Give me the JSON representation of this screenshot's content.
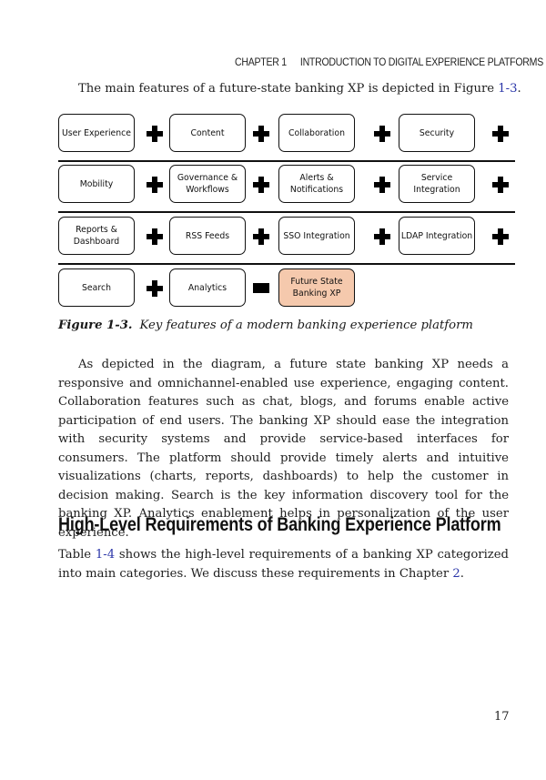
{
  "running_head": {
    "chapter": "CHAPTER 1",
    "title": "INTRODUCTION TO DIGITAL EXPERIENCE PLATFORMS"
  },
  "intro": {
    "before": "The main features of a future-state banking XP is depicted in Figure ",
    "link": "1-3",
    "after": "."
  },
  "diagram": {
    "rows": [
      {
        "items": [
          "User Experience",
          "Content",
          "Collaboration",
          "Security"
        ],
        "operators": [
          "plus",
          "plus",
          "plus",
          "plus"
        ]
      },
      {
        "items": [
          "Mobility",
          "Governance & Workflows",
          "Alerts & Notifications",
          "Service Integration"
        ],
        "operators": [
          "plus",
          "plus",
          "plus",
          "plus"
        ]
      },
      {
        "items": [
          "Reports & Dashboard",
          "RSS Feeds",
          "SSO Integration",
          "LDAP Integration"
        ],
        "operators": [
          "plus",
          "plus",
          "plus",
          "plus"
        ]
      },
      {
        "items": [
          "Search",
          "Analytics",
          "Future State Banking XP"
        ],
        "operators": [
          "plus",
          "equals"
        ]
      }
    ],
    "result_color": "#f5c9ad"
  },
  "caption": {
    "label": "Figure 1-3.",
    "text": "Key features of a modern banking experience platform"
  },
  "paragraph1": "As depicted in the diagram, a future state banking XP needs a responsive and omnichannel-enabled use experience, engaging content. Collaboration features such as chat, blogs, and forums enable active participation of end users. The banking XP should ease the integration with security systems and provide service-based interfaces for consumers. The platform should provide timely alerts and intuitive visualizations (charts, reports, dashboards) to help the customer in decision making. Search is the key information discovery tool for the banking XP. Analytics enablement helps in personalization of the user experience.",
  "heading": "High-Level Requirements of Banking Experience Platform",
  "paragraph2": {
    "t1": "Table ",
    "link1": "1-4",
    "t2": " shows the high-level requirements of a banking XP categorized into main categories. We discuss these requirements in Chapter ",
    "link2": "2",
    "t3": "."
  },
  "page_number": "17",
  "colors": {
    "link": "#2a35a8"
  }
}
